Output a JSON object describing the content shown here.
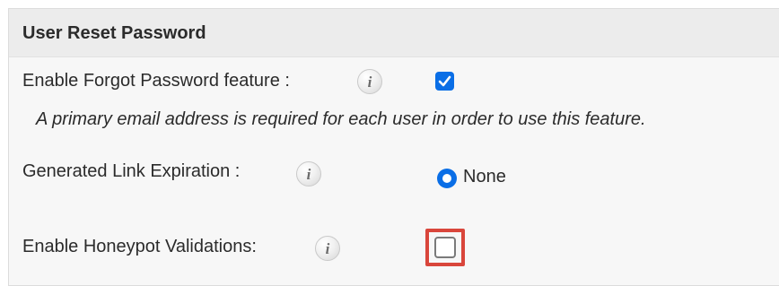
{
  "section": {
    "title": "User Reset Password"
  },
  "rows": {
    "forgot_password": {
      "label": "Enable Forgot Password feature :",
      "info_icon": "info-icon",
      "checked": true
    },
    "note": "A primary email address is required for each user in order to use this feature.",
    "link_expiration": {
      "label": "Generated Link Expiration :",
      "info_icon": "info-icon",
      "selected_option": "None"
    },
    "honeypot": {
      "label": "Enable Honeypot Validations:",
      "info_icon": "info-icon",
      "checked": false
    }
  },
  "colors": {
    "accent": "#0a6ee6",
    "highlight": "#d9463b",
    "panel_bg": "#f7f7f7",
    "header_bg": "#ececec"
  }
}
